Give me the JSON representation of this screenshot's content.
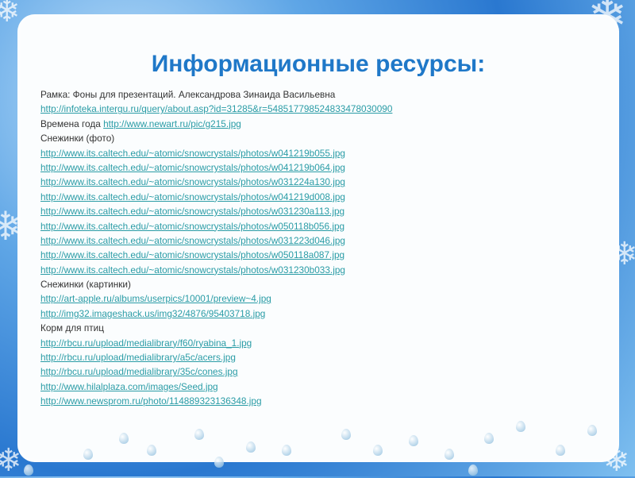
{
  "title": "Информационные ресурсы:",
  "lines": [
    {
      "text": "Рамка: Фоны для презентаций. Александрова Зинаида Васильевна",
      "link": ""
    },
    {
      "text": "",
      "link": "http://infoteka.intergu.ru/query/about.asp?id=31285&r=548517798524833478030090"
    },
    {
      "text": "Времена года ",
      "link": "http://www.newart.ru/pic/g215.jpg"
    },
    {
      "text": "Снежинки (фото)",
      "link": ""
    },
    {
      "text": "",
      "link": "http://www.its.caltech.edu/~atomic/snowcrystals/photos/w041219b055.jpg"
    },
    {
      "text": "",
      "link": "http://www.its.caltech.edu/~atomic/snowcrystals/photos/w041219b064.jpg"
    },
    {
      "text": "",
      "link": "http://www.its.caltech.edu/~atomic/snowcrystals/photos/w031224a130.jpg"
    },
    {
      "text": "",
      "link": "http://www.its.caltech.edu/~atomic/snowcrystals/photos/w041219d008.jpg"
    },
    {
      "text": "",
      "link": "http://www.its.caltech.edu/~atomic/snowcrystals/photos/w031230a113.jpg"
    },
    {
      "text": "",
      "link": "http://www.its.caltech.edu/~atomic/snowcrystals/photos/w050118b056.jpg"
    },
    {
      "text": "",
      "link": "http://www.its.caltech.edu/~atomic/snowcrystals/photos/w031223d046.jpg"
    },
    {
      "text": "",
      "link": "http://www.its.caltech.edu/~atomic/snowcrystals/photos/w050118a087.jpg"
    },
    {
      "text": "",
      "link": "http://www.its.caltech.edu/~atomic/snowcrystals/photos/w031230b033.jpg"
    },
    {
      "text": "Снежинки (картинки)",
      "link": ""
    },
    {
      "text": "",
      "link": "http://art-apple.ru/albums/userpics/10001/preview~4.jpg"
    },
    {
      "text": "",
      "link": "http://img32.imageshack.us/img32/4876/95403718.jpg"
    },
    {
      "text": "Корм для птиц",
      "link": ""
    },
    {
      "text": "",
      "link": "http://rbcu.ru/upload/medialibrary/f60/ryabina_1.jpg"
    },
    {
      "text": "",
      "link": "http://rbcu.ru/upload/medialibrary/a5c/acers.jpg"
    },
    {
      "text": "",
      "link": "http://rbcu.ru/upload/medialibrary/35c/cones.jpg"
    },
    {
      "text": "",
      "link": "http://www.hilalplaza.com/images/Seed.jpg"
    },
    {
      "text": "",
      "link": "http://www.newsprom.ru/photo/114889323136348.jpg"
    }
  ],
  "colors": {
    "title": "#1f78c8",
    "link": "#2a9ca6",
    "frame": "#2a78d0"
  }
}
